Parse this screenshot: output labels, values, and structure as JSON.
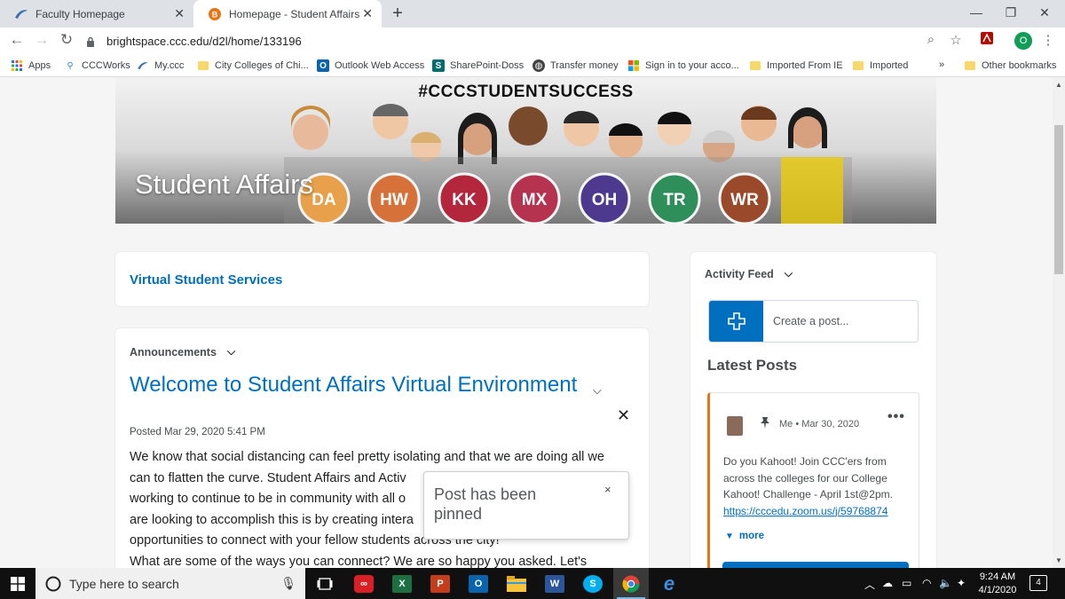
{
  "browser": {
    "tabs": [
      {
        "title": "Faculty Homepage",
        "active": false
      },
      {
        "title": "Homepage - Student Affairs",
        "active": true
      }
    ],
    "url": "brightspace.ccc.edu/d2l/home/133196",
    "profile_initial": "O",
    "bookmarks": [
      {
        "label": "Apps",
        "icon": "apps-grid-icon"
      },
      {
        "label": "CCCWorks",
        "icon": "person-icon"
      },
      {
        "label": "My.ccc",
        "icon": "swoosh-icon"
      },
      {
        "label": "City Colleges of Chi...",
        "icon": "folder-icon"
      },
      {
        "label": "Outlook Web Access",
        "icon": "outlook-icon"
      },
      {
        "label": "SharePoint-Doss",
        "icon": "sharepoint-icon"
      },
      {
        "label": "Transfer money",
        "icon": "globe-icon"
      },
      {
        "label": "Sign in to your acco...",
        "icon": "microsoft-icon"
      },
      {
        "label": "Imported From IE",
        "icon": "folder-icon"
      },
      {
        "label": "Imported",
        "icon": "folder-icon"
      },
      {
        "label": "»",
        "icon": "overflow-icon"
      },
      {
        "label": "Other bookmarks",
        "icon": "folder-icon"
      }
    ]
  },
  "banner": {
    "hashtag": "#CCCSTUDENTSUCCESS",
    "site_title": "Student Affairs",
    "college_codes": [
      "DA",
      "HW",
      "KK",
      "MX",
      "OH",
      "TR",
      "WR"
    ],
    "college_colors": [
      "#e8a04a",
      "#d7713a",
      "#b3263c",
      "#b63350",
      "#4d3a8f",
      "#2f8f5a",
      "#9a4a2a"
    ]
  },
  "virtual_services": {
    "link": "Virtual Student Services"
  },
  "announcements": {
    "widget_title": "Announcements",
    "title": "Welcome to Student Affairs Virtual Environment",
    "posted": "Posted Mar 29, 2020 5:41 PM",
    "body_lines": [
      "We know that social distancing can feel pretty isolating and that we are doing all we",
      "can to flatten the curve.  Student Affairs and Activ",
      "working to continue to be in community with all o",
      "are looking to accomplish this is by creating intera",
      "opportunities to connect with your fellow students across the city!",
      "What are some of the ways you can connect? We are so happy you asked.  Let's"
    ]
  },
  "toast": {
    "message": "Post has been pinned",
    "close": "×"
  },
  "activity_feed": {
    "widget_title": "Activity Feed",
    "create_placeholder": "Create a post...",
    "latest_heading": "Latest Posts",
    "post": {
      "author": "Me",
      "date": "Mar 30, 2020",
      "text": "Do you Kahoot!  Join CCC'ers from across the colleges for our College Kahoot! Challenge - April 1st@2pm.",
      "link": "https://cccedu.zoom.us/j/59768874",
      "more_label": "more",
      "accent": "#e87511"
    }
  },
  "taskbar": {
    "search_placeholder": "Type here to search",
    "time": "9:24 AM",
    "date": "4/1/2020",
    "notification_count": "4",
    "apps": [
      {
        "name": "task-view-icon",
        "label": ""
      },
      {
        "name": "creative-cloud-icon",
        "label": ""
      },
      {
        "name": "excel-icon",
        "label": "X"
      },
      {
        "name": "powerpoint-icon",
        "label": "P"
      },
      {
        "name": "outlook-icon",
        "label": "O"
      },
      {
        "name": "file-explorer-icon",
        "label": ""
      },
      {
        "name": "word-icon",
        "label": "W"
      },
      {
        "name": "skype-icon",
        "label": "S"
      },
      {
        "name": "chrome-icon",
        "label": ""
      },
      {
        "name": "edge-icon",
        "label": "e"
      }
    ]
  },
  "colors": {
    "link_blue": "#006fbf",
    "taskbar": "#101010",
    "brand_orange": "#e87511"
  }
}
